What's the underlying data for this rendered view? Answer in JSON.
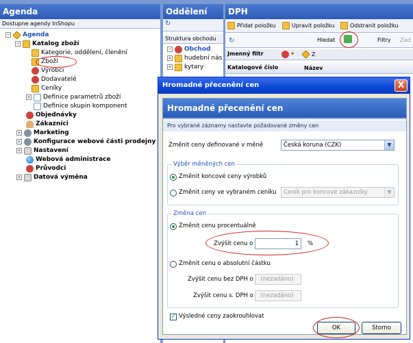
{
  "left_pane": {
    "title": "Agenda",
    "subtitle": "Dostupne agendy InShopu",
    "tree": [
      {
        "label": "Agenda",
        "icon": "cube-icon",
        "bold": true
      },
      {
        "label": "Katalog zboží",
        "icon": "catalog-icon",
        "bold": true
      },
      {
        "label": "Kategorie, oddělení, členění",
        "icon": "folder-icon"
      },
      {
        "label": "Zboží",
        "icon": "folder-icon"
      },
      {
        "label": "Výrobci",
        "icon": "maker-icon"
      },
      {
        "label": "Dodavatelé",
        "icon": "supplier-icon"
      },
      {
        "label": "Ceníky",
        "icon": "price-list-icon"
      },
      {
        "label": "Definice parametrů zboží",
        "icon": "params-icon"
      },
      {
        "label": "Definice skupin komponent",
        "icon": "doc-icon"
      },
      {
        "label": "Objednávky",
        "icon": "orders-icon",
        "bold": true
      },
      {
        "label": "Zákazníci",
        "icon": "customers-icon",
        "bold": true
      },
      {
        "label": "Marketing",
        "icon": "marketing-icon",
        "bold": true
      },
      {
        "label": "Konfigurace webové části prodejny",
        "icon": "gear-icon",
        "bold": true
      },
      {
        "label": "Nastavení",
        "icon": "tools-icon",
        "bold": true
      },
      {
        "label": "Webová administrace",
        "icon": "globe-icon",
        "bold": true
      },
      {
        "label": "Průvodci",
        "icon": "wizard-icon",
        "bold": true
      },
      {
        "label": "Datová výměna",
        "icon": "exchange-icon",
        "bold": true
      }
    ]
  },
  "middle_pane": {
    "title": "Oddělení",
    "subtitle": "Struktura obchodu",
    "tree": [
      {
        "label": "Obchod",
        "bold": true
      },
      {
        "label": "hudební nás"
      },
      {
        "label": "kytary"
      }
    ]
  },
  "right_pane": {
    "title": "DPH",
    "toolbar": {
      "add": "Přidat položku",
      "edit": "Upravit položku",
      "remove": "Odstranit položku",
      "search": "Hledat",
      "filters": "Filtry",
      "filter_placeholder": "Zad"
    },
    "filter_row": {
      "label": "Jmenný filtr",
      "star": "*",
      "z": "Z"
    },
    "columns": [
      "Katalogové číslo",
      "Název"
    ]
  },
  "dialog": {
    "title": "Hromadné přecenění cen",
    "close": "X",
    "header": "Hromadné přecenění cen",
    "description": "Pro vybrané záznamy nastavte požadované změny cen",
    "currency_label": "Změnit ceny definované v měně",
    "currency_value": "Česká koruna (CZK)",
    "group_prices": {
      "title": "Výběr měněných cen",
      "opt_final": "Změnit koncové ceny výrobků",
      "opt_list": "Změnit ceny ve vybraném ceníku",
      "list_value": "Ceník pro koncové zákazníky"
    },
    "group_change": {
      "title": "Změna cen",
      "opt_percent": "Změnit cenu procentuálně",
      "raise_label": "Zvýšit cenu o",
      "raise_value": "1",
      "raise_unit": "%",
      "opt_absolute": "Změnit cenu o absolutní částku",
      "raise_no_vat_label": "Zvýšit cenu bez DPH o",
      "raise_vat_label": "Zvýšit cenu s. DPH o",
      "unset": "(nezadáno)"
    },
    "round_label": "Výsledné ceny zaokrouhlovat",
    "round_check": "✓",
    "ok": "OK",
    "cancel": "Storno"
  }
}
